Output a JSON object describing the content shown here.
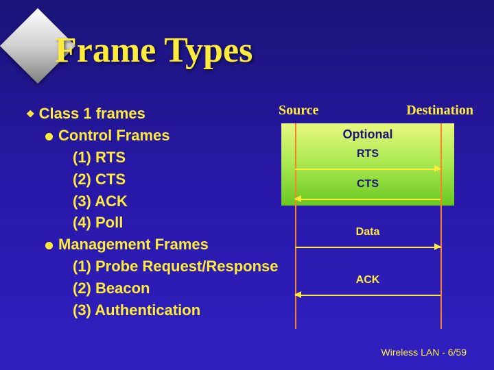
{
  "title": "Frame Types",
  "bullets": {
    "class1": "Class 1 frames",
    "control": "Control Frames",
    "control_items": {
      "i1": "(1) RTS",
      "i2": "(2) CTS",
      "i3": "(3) ACK",
      "i4": "(4) Poll"
    },
    "mgmt": "Management Frames",
    "mgmt_items": {
      "i1": "(1) Probe Request/Response",
      "i2": "(2) Beacon",
      "i3": "(3) Authentication"
    }
  },
  "diagram": {
    "source": "Source",
    "destination": "Destination",
    "optional": "Optional",
    "rts": "RTS",
    "cts": "CTS",
    "data": "Data",
    "ack": "ACK"
  },
  "footer": "Wireless LAN - 6/59"
}
